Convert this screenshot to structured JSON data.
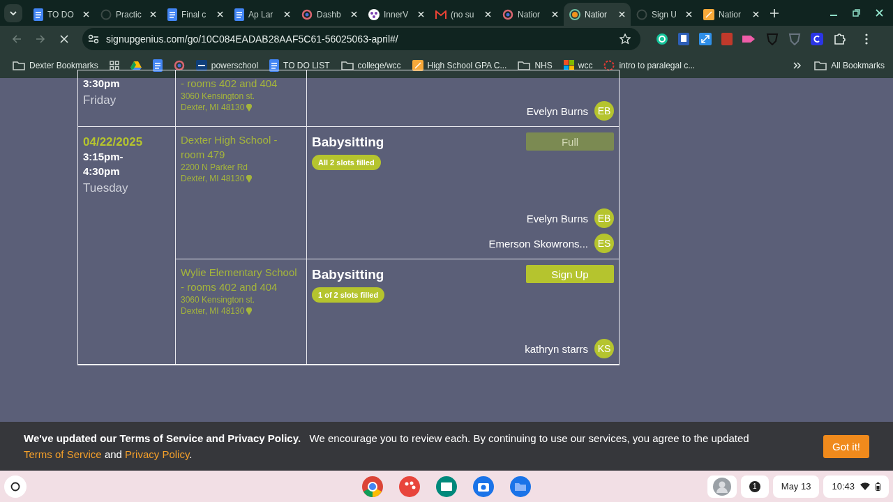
{
  "browser": {
    "tabs": [
      {
        "title": "TO DO",
        "selected": false
      },
      {
        "title": "Practic",
        "selected": false
      },
      {
        "title": "Final c",
        "selected": false
      },
      {
        "title": "Ap Lar",
        "selected": false
      },
      {
        "title": "Dashb",
        "selected": false
      },
      {
        "title": "InnerV",
        "selected": false
      },
      {
        "title": "(no su",
        "selected": false
      },
      {
        "title": "Natior",
        "selected": false
      },
      {
        "title": "Natior",
        "selected": true
      },
      {
        "title": "Sign U",
        "selected": false
      },
      {
        "title": "Natior",
        "selected": false
      }
    ],
    "url": "signupgenius.com/go/10C084EADAB28AAF5C61-56025063-april#/",
    "bookmarks": [
      {
        "label": "Dexter Bookmarks"
      },
      {
        "label": "powerschool"
      },
      {
        "label": "TO DO LIST"
      },
      {
        "label": "college/wcc"
      },
      {
        "label": "High School GPA C..."
      },
      {
        "label": "NHS"
      },
      {
        "label": "wcc"
      },
      {
        "label": "intro to paralegal c..."
      }
    ],
    "all_bookmarks": "All Bookmarks"
  },
  "slots": [
    {
      "time": "3:30pm",
      "day": "Friday",
      "locations": [
        {
          "name": "- rooms 402 and 404",
          "address": "3060 Kensington st.",
          "city": "Dexter, MI 48130",
          "people": [
            {
              "name": "Evelyn Burns",
              "initials": "EB"
            }
          ]
        }
      ]
    },
    {
      "date": "04/22/2025",
      "time": "3:15pm-\n4:30pm",
      "day": "Tuesday",
      "locations": [
        {
          "name": "Dexter High School - room 479",
          "address": "2200 N Parker Rd",
          "city": "Dexter, MI 48130",
          "activity": "Babysitting",
          "badge": "All 2 slots filled",
          "button": {
            "label": "Full",
            "kind": "full"
          },
          "people": [
            {
              "name": "Evelyn Burns",
              "initials": "EB"
            },
            {
              "name": "Emerson Skowrons...",
              "initials": "ES"
            }
          ]
        },
        {
          "name": "Wylie Elementary School - rooms 402 and 404",
          "address": "3060 Kensington st.",
          "city": "Dexter, MI 48130",
          "activity": "Babysitting",
          "badge": "1 of 2 slots filled",
          "button": {
            "label": "Sign Up",
            "kind": "signup"
          },
          "people": [
            {
              "name": "kathryn starrs",
              "initials": "KS"
            }
          ]
        }
      ]
    }
  ],
  "cookie_banner": {
    "bold": "We've updated our Terms of Service and Privacy Policy.",
    "text": "We encourage you to review each. By continuing to use our services, you agree to the updated",
    "link1": "Terms of Service",
    "and": "and",
    "link2": "Privacy Policy",
    "end": ".",
    "button": "Got it!"
  },
  "shelf": {
    "notifications": "1",
    "date": "May 13",
    "time": "10:43"
  }
}
